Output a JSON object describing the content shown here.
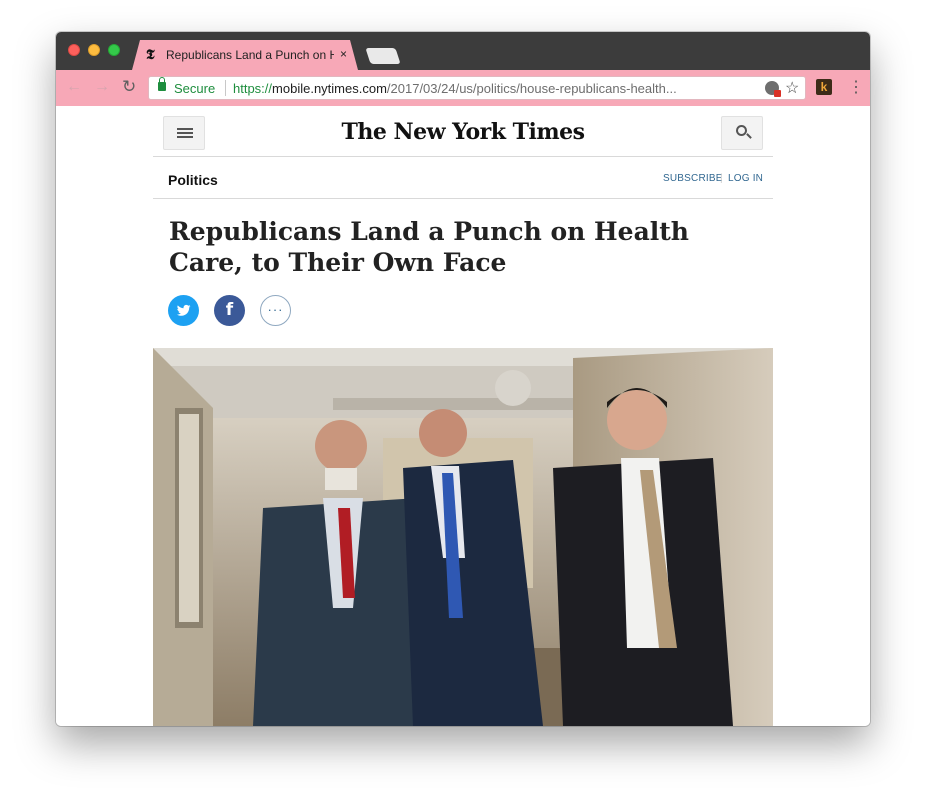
{
  "browser": {
    "tab": {
      "favicon": "𝕿",
      "title": "Republicans Land a Punch on He",
      "close_glyph": "×"
    },
    "toolbar": {
      "back_glyph": "←",
      "forward_glyph": "→",
      "reload_glyph": "↻",
      "security_label": "Secure",
      "url_scheme": "https://",
      "url_host": "mobile.nytimes.com",
      "url_path": "/2017/03/24/us/politics/house-republicans-health...",
      "star_glyph": "☆",
      "extension_letter": "k",
      "menu_glyph": "⋮"
    }
  },
  "page": {
    "masthead": "The New York Times",
    "section": "Politics",
    "subscribe_label": "SUBSCRIBE",
    "divider": "|",
    "login_label": "LOG IN",
    "headline": "Republicans Land a Punch on Health Care, to Their Own Face",
    "share": {
      "facebook_glyph": "f",
      "more_glyph": "···"
    }
  },
  "colors": {
    "tab_and_toolbar": "#f7a8b7",
    "secure_green": "#1e8e3e",
    "link_blue": "#326891",
    "twitter": "#1da1f2",
    "facebook": "#3b5998"
  },
  "icons": [
    "hamburger-menu-icon",
    "search-icon",
    "twitter-icon",
    "facebook-icon",
    "more-icon",
    "lock-icon",
    "star-icon",
    "close-icon"
  ]
}
